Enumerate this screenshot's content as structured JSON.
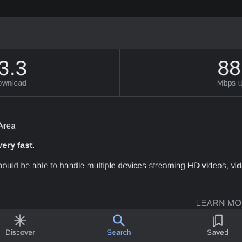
{
  "colors": {
    "background": "#202124",
    "header_band": "#2d2f33",
    "nav_background": "#2d2f33",
    "text_primary": "#e8eaed",
    "text_secondary": "#9aa0a6",
    "accent": "#8ab4f8"
  },
  "metrics": {
    "download": {
      "value": "3.3",
      "label": "ownload"
    },
    "upload": {
      "value": "88",
      "label": "Mbps up"
    }
  },
  "content": {
    "area_text": "Area",
    "speed_text": "very fast.",
    "description_text": "hould be able to handle multiple devices streaming HD videos, video"
  },
  "actions": {
    "learn_more_label": "LEARN MOR"
  },
  "bottom_nav": {
    "items": [
      {
        "label": "Discover",
        "icon": "asterisk-icon",
        "active": false
      },
      {
        "label": "Search",
        "icon": "search-icon",
        "active": true
      },
      {
        "label": "Saved",
        "icon": "bookmarks-icon",
        "active": false
      }
    ]
  }
}
